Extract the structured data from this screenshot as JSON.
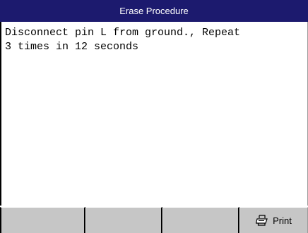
{
  "window": {
    "title": "Erase Procedure"
  },
  "content": {
    "line1": "Disconnect pin L from ground., Repeat",
    "line2": "3 times in 12 seconds"
  },
  "toolbar": {
    "buttons": [
      {
        "label": ""
      },
      {
        "label": ""
      },
      {
        "label": ""
      },
      {
        "label": "Print",
        "icon": "printer-icon"
      }
    ]
  },
  "colors": {
    "titlebar": "#1c1a6e",
    "toolbar": "#c6c6c6"
  }
}
